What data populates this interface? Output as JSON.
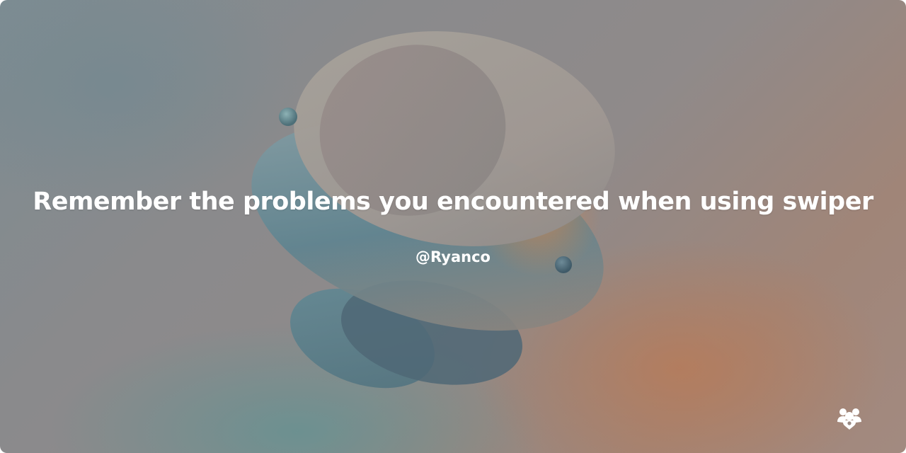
{
  "card": {
    "title": "Remember the problems you encountered when using swiper",
    "author": "@Ryanco"
  },
  "icons": {
    "brand_logo": "community-people-icon"
  },
  "colors": {
    "text": "#ffffff",
    "accent_orange": "#be7850",
    "accent_teal": "#509696"
  }
}
